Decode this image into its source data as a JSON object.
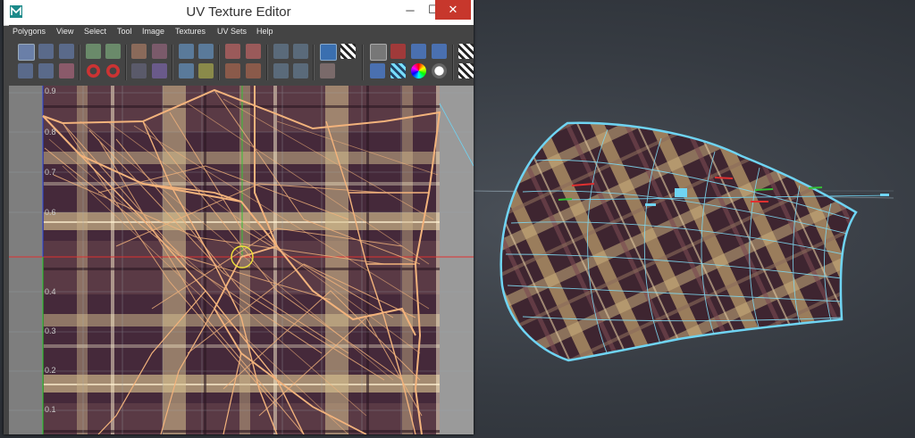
{
  "window": {
    "title": "UV Texture Editor",
    "min_symbol": "─",
    "max_symbol": "☐",
    "close_symbol": "✕"
  },
  "menu": [
    "Polygons",
    "View",
    "Select",
    "Tool",
    "Image",
    "Textures",
    "UV Sets",
    "Help"
  ],
  "uv_labels": [
    "0.9",
    "0.8",
    "0.7",
    "0.6",
    "0.4",
    "0.3",
    "0.2",
    "0.1"
  ],
  "colors": {
    "wireframe": "#f3b37c",
    "selection": "#6fd4f3",
    "axis_u": "#e03030",
    "axis_v": "#35c035",
    "pivot": "#f0e23a"
  }
}
